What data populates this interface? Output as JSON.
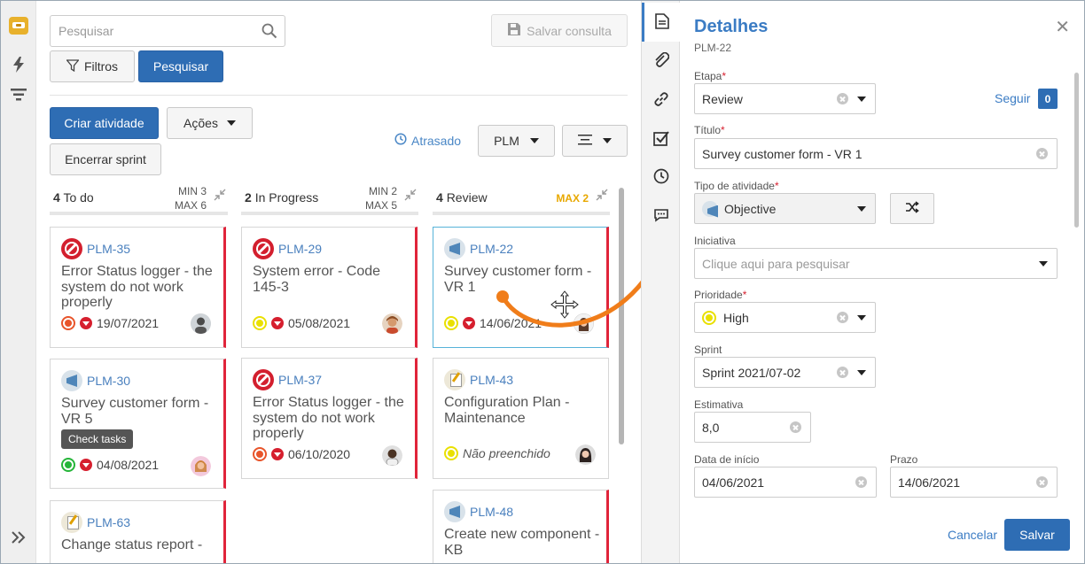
{
  "search": {
    "placeholder": "Pesquisar"
  },
  "toolbar": {
    "save_query": "Salvar consulta",
    "filters": "Filtros",
    "search": "Pesquisar",
    "create_activity": "Criar atividade",
    "actions": "Ações",
    "close_sprint": "Encerrar sprint",
    "late": "Atrasado",
    "project": "PLM"
  },
  "columns": [
    {
      "count": "4",
      "name": "To do",
      "min": "MIN 3",
      "max": "MAX 6"
    },
    {
      "count": "2",
      "name": "In Progress",
      "min": "MIN 2",
      "max": "MAX 5"
    },
    {
      "count": "4",
      "name": "Review",
      "max": "MAX 2"
    }
  ],
  "cards": [
    {
      "key": "PLM-35",
      "title": "Error Status logger - the system do not work properly",
      "date": "19/07/2021",
      "type_icon": "ban-icon",
      "priority": "red"
    },
    {
      "key": "PLM-30",
      "title": "Survey customer form - VR 5",
      "date": "04/08/2021",
      "type_icon": "objective-icon",
      "priority": "green"
    },
    {
      "key": "PLM-63",
      "title": "Change status report -",
      "type_icon": "plan-icon"
    },
    {
      "key": "PLM-29",
      "title": "System error - Code 145-3",
      "date": "05/08/2021",
      "type_icon": "ban-icon",
      "priority": "yellow"
    },
    {
      "key": "PLM-37",
      "title": "Error Status logger - the system do not work properly",
      "date": "06/10/2020",
      "type_icon": "ban-icon",
      "priority": "red"
    },
    {
      "key": "PLM-22",
      "title": "Survey customer form - VR 1",
      "date": "14/06/2021",
      "type_icon": "objective-icon",
      "priority": "yellow"
    },
    {
      "key": "PLM-43",
      "title": "Configuration Plan - Maintenance",
      "date": "Não preenchido",
      "type_icon": "plan-icon",
      "priority": "yellow"
    },
    {
      "key": "PLM-48",
      "title": "Create new component - KB",
      "type_icon": "objective-icon"
    }
  ],
  "tooltip": "Check tasks",
  "details": {
    "title": "Detalhes",
    "key": "PLM-22",
    "stage_label": "Etapa",
    "stage_value": "Review",
    "follow": "Seguir",
    "follow_count": "0",
    "title_label": "Título",
    "title_value": "Survey customer form - VR 1",
    "type_label": "Tipo de atividade",
    "type_value": "Objective",
    "initiative_label": "Iniciativa",
    "initiative_placeholder": "Clique aqui para pesquisar",
    "priority_label": "Prioridade",
    "priority_value": "High",
    "sprint_label": "Sprint",
    "sprint_value": "Sprint 2021/07-02",
    "estimate_label": "Estimativa",
    "estimate_value": "8,0",
    "start_label": "Data de início",
    "start_value": "04/06/2021",
    "deadline_label": "Prazo",
    "deadline_value": "14/06/2021",
    "cancel": "Cancelar",
    "save": "Salvar"
  },
  "colors": {
    "accent": "#2e6db4",
    "link": "#3b7cc4",
    "overdue": "#e0243a",
    "warn": "#e8a800",
    "arrow": "#f07d1a"
  }
}
